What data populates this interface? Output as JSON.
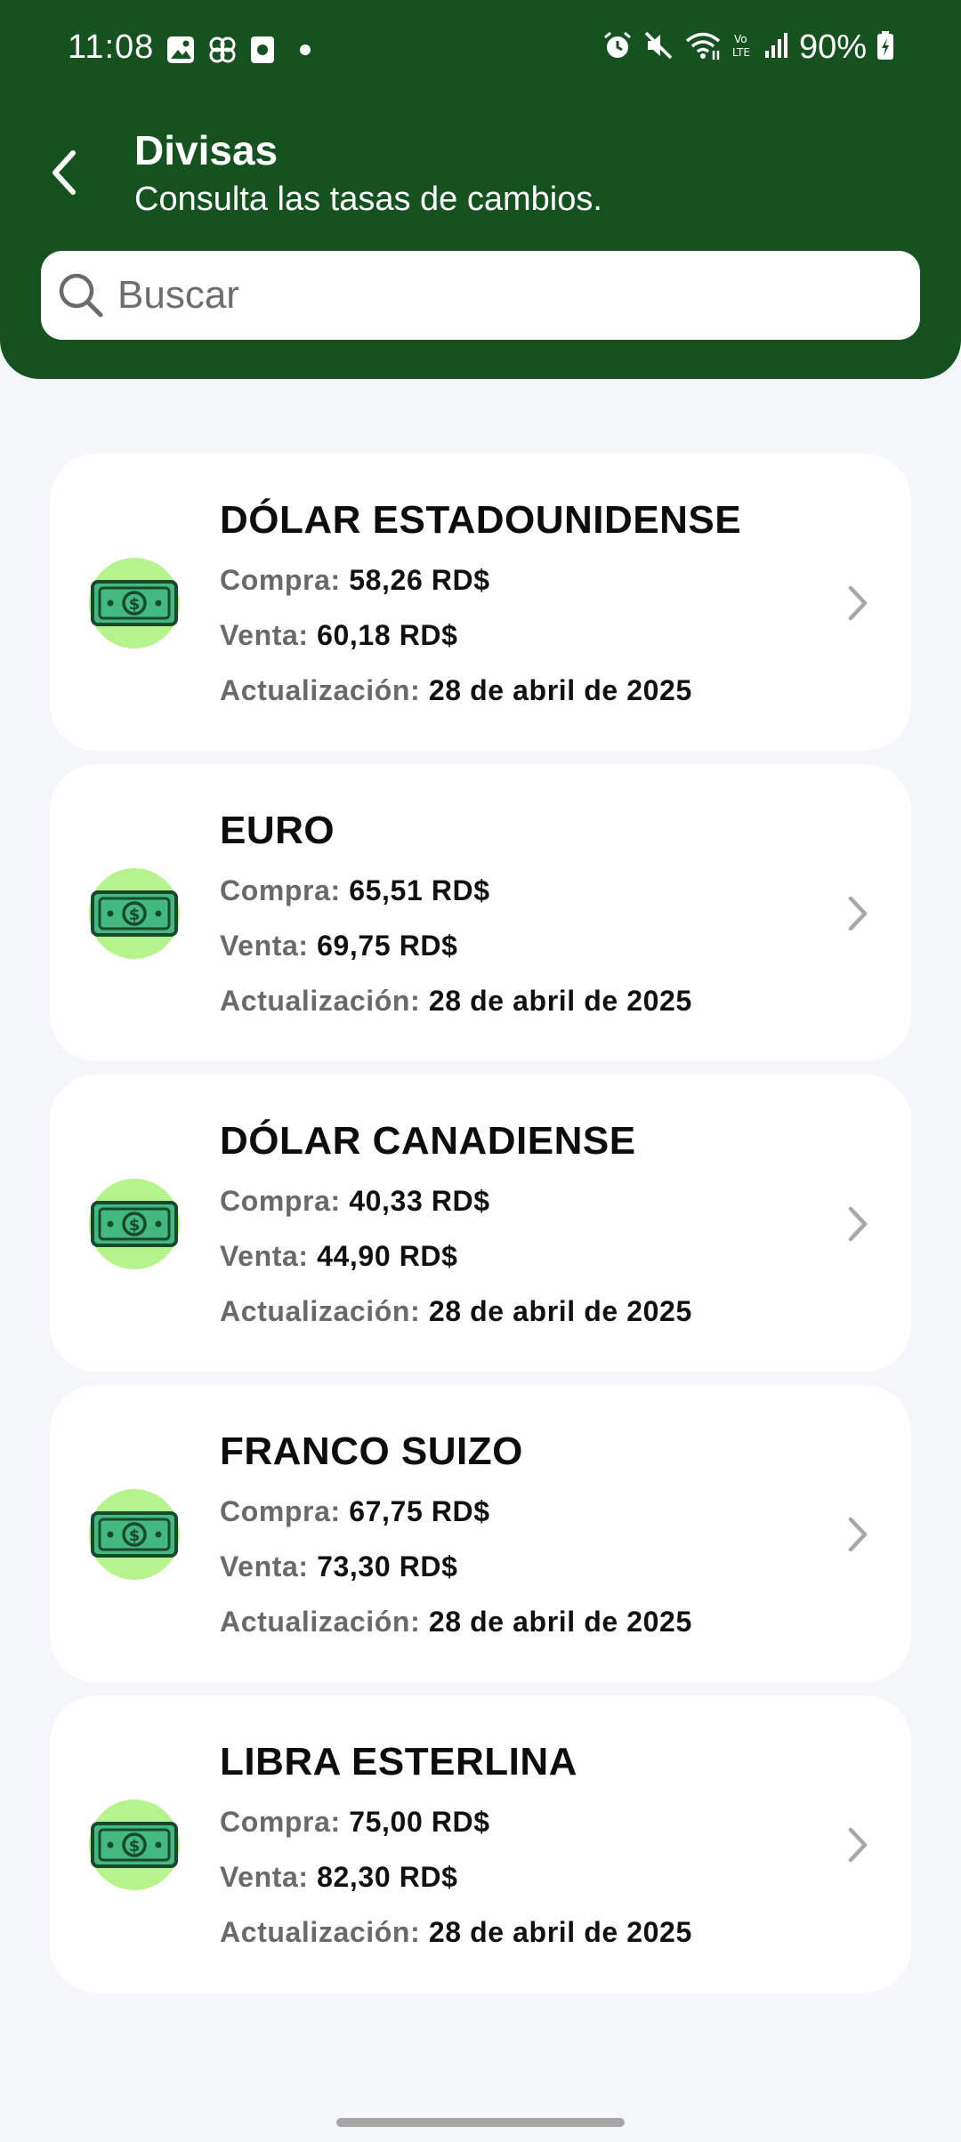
{
  "status_bar": {
    "time": "11:08",
    "battery": "90%",
    "left_icons": [
      "gallery-icon",
      "pinwheel-icon",
      "app-icon",
      "dot-icon"
    ],
    "right_icons": [
      "alarm-icon",
      "mute-icon",
      "wifi-icon",
      "volte-icon",
      "signal-icon",
      "battery-icon"
    ]
  },
  "header": {
    "title": "Divisas",
    "subtitle": "Consulta las tasas de cambios.",
    "back_icon": "chevron-left-icon",
    "background_color": "#165220"
  },
  "search": {
    "placeholder": "Buscar",
    "value": ""
  },
  "labels": {
    "compra": "Compra:",
    "venta": "Venta:",
    "actualizacion": "Actualización:"
  },
  "currencies": [
    {
      "name": "DÓLAR ESTADOUNIDENSE",
      "compra": "58,26 RD$",
      "venta": "60,18 RD$",
      "actualizacion": "28 de abril de 2025"
    },
    {
      "name": "EURO",
      "compra": "65,51 RD$",
      "venta": "69,75 RD$",
      "actualizacion": "28 de abril de 2025"
    },
    {
      "name": "DÓLAR CANADIENSE",
      "compra": "40,33 RD$",
      "venta": "44,90 RD$",
      "actualizacion": "28 de abril de 2025"
    },
    {
      "name": "FRANCO SUIZO",
      "compra": "67,75 RD$",
      "venta": "73,30 RD$",
      "actualizacion": "28 de abril de 2025"
    },
    {
      "name": "LIBRA ESTERLINA",
      "compra": "75,00 RD$",
      "venta": "82,30 RD$",
      "actualizacion": "28 de abril de 2025"
    }
  ],
  "colors": {
    "accent": "#165220",
    "icon_circle": "#b5f48d",
    "page_background": "#f4f6fa"
  }
}
